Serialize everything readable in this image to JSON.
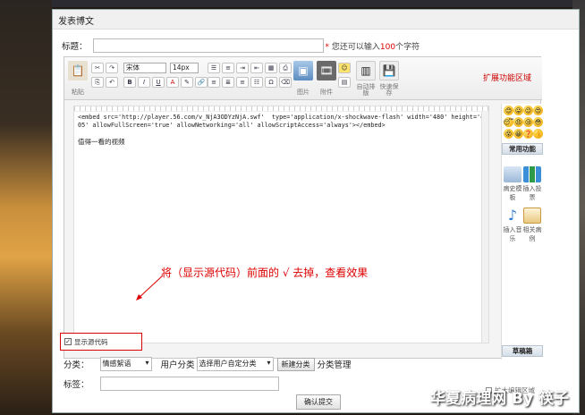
{
  "dialog": {
    "title": "发表博文"
  },
  "form": {
    "title_label": "标题：",
    "title_hint_pre": "您还可以输入",
    "title_hint_num": "100",
    "title_hint_post": "个字符",
    "category_label": "分类：",
    "category_value": "情感絮语",
    "user_category_label": "用户分类",
    "user_category_value": "选择用户自定分类",
    "new_category_button": "新建分类",
    "manage_category_link": "分类管理",
    "tags_label": "标签：",
    "submit_button": "确认提交"
  },
  "toolbar": {
    "paste_label": "粘贴",
    "font_family": "宋体",
    "font_size": "14px",
    "image_label": "图片",
    "attachment_label": "附件",
    "auto_layout_label": "自动排版",
    "quick_save_label": "快速保存",
    "extend_area_label": "扩展功能区域"
  },
  "editor": {
    "code_text": "<embed src='http://player.56.com/v_NjA3ODYzNjA.swf'  type='application/x-shockwave-flash' width='480' height='405' allowFullScreen='true' allowNetworking='all' allowScriptAccess='always'></embed>",
    "body_text": "值得一看的视频",
    "show_source_label": "显示源代码",
    "expand_label": "扩大编辑区域"
  },
  "side": {
    "common_header": "常用功能",
    "functions": [
      "病史模板",
      "插入投票",
      "插入音乐",
      "相关病例"
    ],
    "draft_header": "草稿箱"
  },
  "annotation": "将（显示源代码）前面的 √ 去掉，查看效果",
  "watermark": "华夏病理网 By 筷子"
}
